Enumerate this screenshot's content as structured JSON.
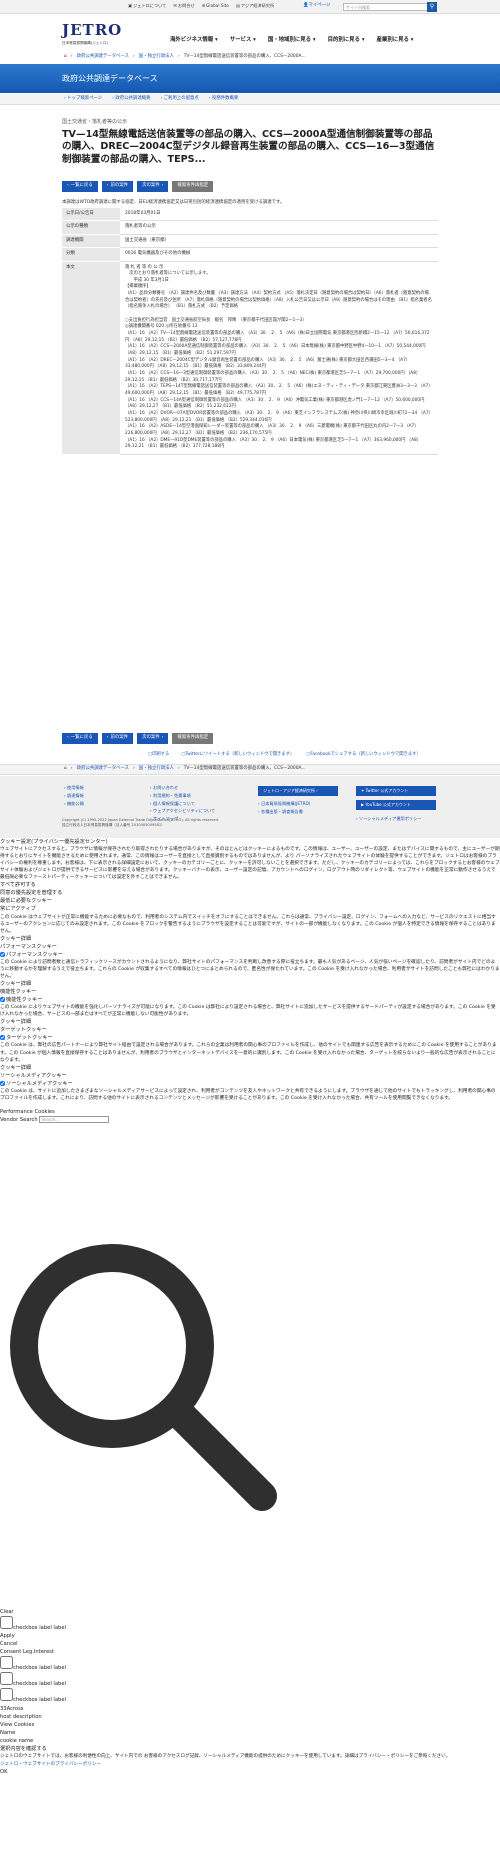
{
  "util": {
    "links": [
      "ジェトロについて",
      "お問合せ",
      "Global Site",
      "アジア経済研究所"
    ],
    "mypage": "マイページ",
    "search_placeholder": "サイト内検索"
  },
  "brand": {
    "logo": "JETRO",
    "sub": "日本貿易振興機構(ジェトロ)"
  },
  "gnav": [
    "海外ビジネス情報 ▾",
    "サービス ▾",
    "国・地域別に見る ▾",
    "目的別に見る ▾",
    "産業別に見る ▾"
  ],
  "crumb": [
    "ホーム",
    "政府公共調達データベース",
    "国・独立行政法人",
    "TV—14型無線電話送信装置等の部品の購入、CCS—2000A..."
  ],
  "banner": "政府公共調達データベース",
  "subnav": [
    "トップ検索ページ",
    "政府公共調達概要",
    "ご利用上の留意点",
    "役務件数概要"
  ],
  "category": "国土交通省・落札者等の公示",
  "title": "TV—14型無線電話送信装置等の部品の購入、CCS—2000A型通信制御装置等の部品の購入、DREC—2004C型デジタル録音再生装置の部品の購入、CCS—16—3型通信制御装置の部品の購入、TEPS...",
  "buttons": [
    "一覧に戻る",
    "前の案件",
    "次の案件",
    "検索条件再指定"
  ],
  "note": "本調達はWTO政府調達に関する協定、日EU経済連携協定又は日英包括的経済連携協定の適用を受ける調達です。",
  "table": [
    {
      "th": "公示日/公告日",
      "td": "2018年03月01日"
    },
    {
      "th": "公示の種類",
      "td": "落札者等の公示"
    },
    {
      "th": "調達機関",
      "td": "国土交通省（東京都）"
    },
    {
      "th": "分類",
      "td": "0016 電気機器及びその他の機械"
    },
    {
      "th": "本文",
      "td": "落 札 者 等 の 公 示\n　次のとおり落札者等について公示します。\n　　平成 30 年3月1日\n【掲載順序】\n（A1）品目分類番号 （A2）調達件名及び数量 （A3）調達方法 （A4）契約方式 （A5）落札決定日（随意契約の場合は契約日）（A6）落札者（随意契約の場合は契約者）の氏名及び住所 （A7）落札価格（随意契約の場合は契約価格）（A8）入札公告日又は公示日（A9）随意契約の場合はその理由 （B1）指名業者名（指名競争入札の場合） （B1）落札方式 （B2）予定価格\n\n○支出負担行為担当官　国土交通省航空局長　蝦名　邦晴　（東京都千代田区霞が関2—1—3）\n◎調達機関番号 020 ◎所在地番号 13\n（A1）16 （A2）TV—14型無線電話送信装置等の部品の購入 （A3）30． 2． 5 （A6）(株)日立国際電気 東京都港区西新橋2—15—12 （A7）56,616,372円 （A8）29,12,15 （B1）最低価格 （B2）57,127,778円\n（A1）16 （A2）CCS—2000A型通信制御装置等の部品の購入 （A3）30． 2． 5 （A6）日本無線(株) 東京都中野区中野4—10—1 （A7）50,544,000円 （A8）29,12,15 （B1）最低価格 （B2）51,297,597円\n（A1）16 （A2）DREC—2004C型デジタル録音再生装置の部品の購入 （A3）30． 2． 5 （A6）富士通(株) 東京都大田区西蒲田5—3—4 （A7）33,480,000円 （A8）29,12,15 （B1）最低価格 （B2）33,809,244円\n（A1）16 （A2）CCS—16—3型通信制御装置等の部品の購入 （A3）30． 2． 5 （A6）NEC(株) 東京都港区芝5—7—1 （A7）29,700,000円 （A8）29,12,15 （B1）最低価格 （B2）30,717,177円\n（A1）16 （A2）TEPS—14T型無線電話送信装置等の部品の購入 （A3）30． 2． 5 （A6）(株)エヌ・ティ・ティ・データ 東京都江東区豊洲3—3—3 （A7）49,600,000円 （A8）29,12,15 （B1）最低価格 （B2）49,775,787円\n（A1）16 （A2）CCS—14A型通信制御装置等の部品の購入 （A3）30． 2． 9 （A6）沖電気工業(株) 東京都港区虎ノ門1—7—12 （A7）50,600,000円 （A8）29,12,27 （B1）最低価格 （B2）51,232,612円\n（A1）16 （A2）DVOR—07A型DVOR装置等の部品の購入 （A3）30． 2． 9 （A6）東芝インフラシステムズ(株) 神奈川県川崎市幸区堀川町72—34 （A7）523,800,000円 （A8）29,12,21 （B1）最低価格 （B2）529,344,016円\n（A1）16 （A2）ASDE—14型空港面探知レーダー装置等の部品の購入 （A3）30． 2． 9 （A6）三菱電機(株) 東京都千代田区丸の内2—7—3 （A7）226,800,000円 （A8）29,12,27 （B1）最低価格 （B2）236,170,575円\n（A1）16 （A2）DME—91D型DME装置等の部品の購入 （A3）30． 2． 9 （A6）日本電気(株) 東京都港区芝5—7—1 （A7）363,960,000円 （A8）29,12,21 （B1）最低価格 （B2）377,728,188円"
    }
  ],
  "share": [
    "印刷する",
    "Twitterにツイートする（新しいウィンドウで開きます）",
    "Facebookでシェアする（新しいウィンドウで開きます）"
  ],
  "footer": {
    "col1": [
      "使用情報",
      "調達情報",
      "機能公開"
    ],
    "col2": [
      "お問い合わせ",
      "利用規約・免責事項",
      "個人情報保護について",
      "ウェブアクセシビリティについて",
      "サイトマップ"
    ],
    "col3btn": "ジェトロ・アジア経済研究所",
    "col3": [
      "日本貿易振興機構(JETRO)",
      "各種出版・調査報告書"
    ],
    "twitter": "Twitter 公式アカウント",
    "youtube": "YouTube 公式アカウント",
    "social": "ソーシャルメディア運用ポリシー",
    "copy1": "Copyright (C) 1995-2022 Japan External Trade Organization(JETRO). All rights reserved.",
    "copy2": "独立行政法人日本貿易振興機構（法人番号 2010405009581）"
  },
  "cookie": {
    "h1": "クッキー設定(プライバシー優先設定センター)",
    "intro": "ウェブサイトにアクセスすると、ブラウザに情報が保存されたり取得されたりする場合がありますが、そのほとんどはクッキーによるものです。この情報は、ユーザー、ユーザーの設定、またはデバイスに関するもので、主にユーザーが期待するとおりにサイトを機能させるために使用されます。通常、この情報はユーザーを直接として直接識別するものではありませんが、より パーソナライズされたウェブサイトの体験を提供することができます。ジェトロはお客様のプライバシーの権利を尊重します。お客様は、下に表示される詳細設定において、クッキーのカテゴリーごとに、クッキーを許可しないことを選択できます。ただし、クッキーのカテゴリーによっては、これらをブロックするとお客様のウェブサイト体験およびジェトロが提供できるサービスに影響を与える場合があります。クッキーバナーの表示、ユーザー設定の記憶、アカウントへのログイン、ログアウト時のリダイレクト等、ウェブサイトの機能を正常に動作させるうえで最低限必要なファーストパーティークッキーについては設定を外すことはできません。",
    "allow_all": "すべて許可する",
    "manage": "同意の優先設定を管理する",
    "strict_h": "最低に必要なクッキー",
    "always": "常にアクティブ",
    "strict_p": "この Cookie はウェブサイトが正常に機能するために必要なもので、利用者のシステム内でスイッチをオフにすることはできません。これらは通常、プライバシー設定、ログイン、フォームへの入力など、サービスのリクエストに相当するユーザーのアクションに応じてのみ設定されます。この Cookie をブロックを警告するようにブラウザを設定することは可能ですが、サイトの一部が機能しなくなります。この Cookie が個人を特定できる情報を保存することはありません。",
    "cookie_detail": "クッキー詳細",
    "perf_h": "パフォーマンスクッキー",
    "perf_c": "パフォーマンスクッキー",
    "perf_p": "この Cookie により訪問者数と通信トラフィックソースがカウントされるようになり、弊社サイトのパフォーマンスを判断し改善する際に役立ちます。最も人気があるページ、人気が低いページを確認したり、訪問者がサイト内でどのように移動するかを理解するうえで役立ちます。これらの Cookie が収集するすべての情報はひとつにまとめられるので、匿名性が保たれています。この Cookie を受け入れなかった場合、利用者がサイトを訪問したことも弊社にはわかりません。",
    "func_h": "機能性クッキー",
    "func_c": "機能性クッキー",
    "func_p": "この Cookie によりウェブサイトの機能を強化しパーソナライズが可能になります。この Cookie は弊社により設定される場合と、弊社サイトに追加したサービスを提供するサードパーティが設定する場合があります。この Cookie を受け入れなかった場合、サービスの一部またはすべてが正常に機能しない可能性があります。",
    "target_h": "ターゲットクッキー",
    "target_c": "ターゲットクッキー",
    "target_p": "この Cookie は、弊社の広告パートナーにより弊社サイト経由で設定される場合があります。これらの企業は利用者の関心事のプロファイルを作成し、他のサイトでも関連する広告を表示するためにこの Cookie を使用することがあります。この Cookie が個人情報を直接保存することはありませんが、利用者のブラウザとインターネットデバイスを一意的に識別します。この Cookie を受け入れなかった場合、ターゲットを絞らないより一般的な広告が表示されることになります。",
    "social_h": "ソーシャルメディアクッキー",
    "social_c": "ソーシャルメディアクッキー",
    "social_p": "この Cookie は、サイトに追加したさまざまなソーシャルメディアサービスによって設定され、利用者がコンテンツを友人やネットワークと共有できるようにします。ブラウザを通じて他のサイトでもトラッキングし、利用者の関心事のプロファイルを作成します。これにより、訪問する他のサイトに表示されるコンテンツとメッセージが影響を受けることがあります。この Cookie を受け入れなかった場合、共有ツールを使用閲覧できなくなります。",
    "perf_cookies": "Performance Cookies",
    "vendor": "Vendor Search",
    "vendor_ph": "Search..."
  },
  "tail": {
    "items": [
      "Clear",
      "checkbox label label",
      "Apply",
      "Cancel",
      "Consent Leg.Interest",
      "checkbox label label",
      "checkbox label label",
      "checkbox label label",
      "33Across",
      "host description",
      "View Cookies",
      "Name",
      "cookie name"
    ],
    "confirm": "選択内容を確認する",
    "policy_text": "ジェトロのウェブサイトでは、お客様の利便性の向上、サイト内での お客様のアクセスログ記録、ソーシャルメディア機能の提供のためにクッキーを使用しています。詳細はプライバシー・ポリシーをご参照ください。",
    "policy_link": "ジェトロ・ウェブサイトのプライバシーポリシー",
    "ok": "OK"
  }
}
